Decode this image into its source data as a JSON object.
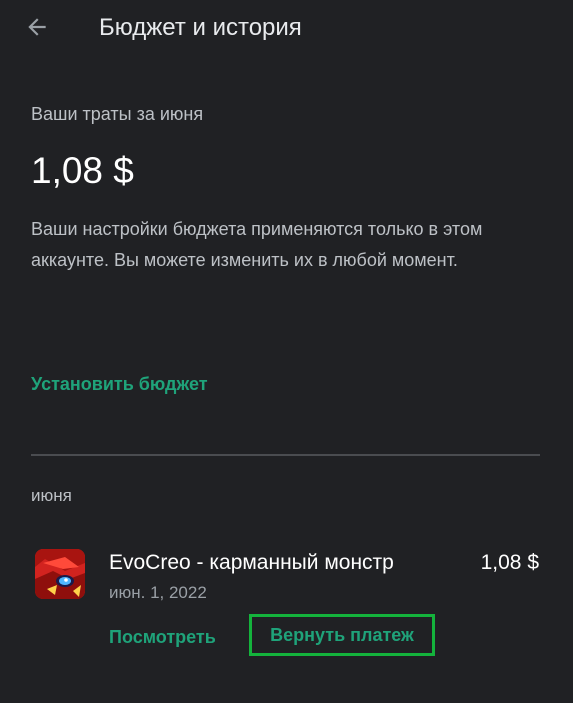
{
  "header": {
    "back_icon": "arrow-left-icon",
    "title": "Бюджет и история"
  },
  "spending": {
    "label": "Ваши траты за июня",
    "amount": "1,08 $",
    "note": "Ваши настройки бюджета применяются только в этом аккаунте. Вы можете изменить их в любой момент.",
    "set_budget_label": "Установить бюджет"
  },
  "history": {
    "month_label": "июня",
    "items": [
      {
        "icon": "evocreo-app-icon",
        "name": "EvoCreo - карманный монстр",
        "date": "июн. 1, 2022",
        "price": "1,08 $",
        "view_label": "Посмотреть",
        "refund_label": "Вернуть платеж"
      }
    ]
  },
  "colors": {
    "background": "#202124",
    "accent": "#1fa37a",
    "highlight_border": "#14b33c"
  }
}
